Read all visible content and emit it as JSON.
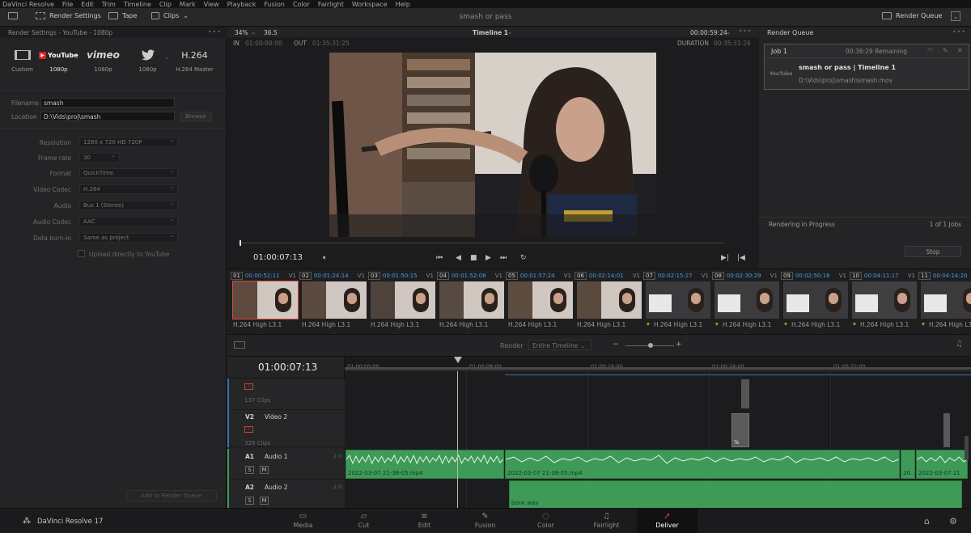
{
  "menu": [
    "DaVinci Resolve",
    "File",
    "Edit",
    "Trim",
    "Timeline",
    "Clip",
    "Mark",
    "View",
    "Playback",
    "Fusion",
    "Color",
    "Fairlight",
    "Workspace",
    "Help"
  ],
  "toolbar": {
    "render_settings": "Render Settings",
    "tape": "Tape",
    "clips": "Clips",
    "project_title": "smash or pass",
    "render_queue": "Render Queue"
  },
  "render_settings": {
    "header": "Render Settings - YouTube - 1080p",
    "presets": [
      {
        "logo": "",
        "label": "Custom"
      },
      {
        "logo": "YouTube",
        "label": "1080p"
      },
      {
        "logo": "vimeo",
        "label": "1080p"
      },
      {
        "logo": "twitter",
        "label": "1080p"
      },
      {
        "logo": "H.264",
        "label": "H.264 Master"
      }
    ],
    "filename_label": "Filename",
    "filename": "smash",
    "location_label": "Location",
    "location": "D:\\Vids\\proj\\smash",
    "browse": "Browse",
    "fields": [
      {
        "label": "Resolution",
        "value": "1280 x 720 HD 720P"
      },
      {
        "label": "Frame rate",
        "value": "30"
      },
      {
        "label": "Format",
        "value": "QuickTime"
      },
      {
        "label": "Video Codec",
        "value": "H.264"
      },
      {
        "label": "Audio",
        "value": "Bus 1 (Stereo)"
      },
      {
        "label": "Audio Codec",
        "value": "AAC"
      },
      {
        "label": "Data burn-in",
        "value": "Same as project"
      }
    ],
    "upload": "Upload directly to YouTube",
    "add_to_queue": "Add to Render Queue"
  },
  "viewer": {
    "zoom": "34%",
    "fps": "36.5",
    "timeline_name": "Timeline 1",
    "duration_tc": "00:00:59:24",
    "in_label": "IN",
    "in_tc": "01:00:00:00",
    "out_label": "OUT",
    "out_tc": "01:35:31:25",
    "duration_label": "DURATION",
    "duration_val": "00:35:31:26",
    "timecode": "01:00:07:13"
  },
  "render_queue": {
    "title": "Render Queue",
    "job_name": "Job 1",
    "remaining": "00:36:29 Remaining",
    "job_title": "smash or pass | Timeline 1",
    "job_path": "D:\\Vids\\proj\\smash\\smash.mov",
    "job_logo": "YouTube",
    "status": "Rendering in Progress",
    "count": "1 of 1 Jobs",
    "stop": "Stop"
  },
  "clips": [
    {
      "num": "01",
      "tc": "00:00:52:11",
      "track": "V1",
      "codec": "H.264 High L3.1",
      "star": false
    },
    {
      "num": "02",
      "tc": "00:01:24:14",
      "track": "V1",
      "codec": "H.264 High L3.1",
      "star": false
    },
    {
      "num": "03",
      "tc": "00:01:50:15",
      "track": "V1",
      "codec": "H.264 High L3.1",
      "star": false
    },
    {
      "num": "04",
      "tc": "00:01:52:08",
      "track": "V1",
      "codec": "H.264 High L3.1",
      "star": false
    },
    {
      "num": "05",
      "tc": "00:01:57:24",
      "track": "V1",
      "codec": "H.264 High L3.1",
      "star": false
    },
    {
      "num": "06",
      "tc": "00:02:14:01",
      "track": "V1",
      "codec": "H.264 High L3.1",
      "star": false
    },
    {
      "num": "07",
      "tc": "00:02:15:27",
      "track": "V1",
      "codec": "H.264 High L3.1",
      "star": true
    },
    {
      "num": "08",
      "tc": "00:02:30:29",
      "track": "V1",
      "codec": "H.264 High L3.1",
      "star": true
    },
    {
      "num": "09",
      "tc": "00:02:50:16",
      "track": "V1",
      "codec": "H.264 High L3.1",
      "star": true
    },
    {
      "num": "10",
      "tc": "00:04:11:17",
      "track": "V1",
      "codec": "H.264 High L3.1",
      "star": true
    },
    {
      "num": "11",
      "tc": "00:04:14:20",
      "track": "V1",
      "codec": "H.264 High L3.1",
      "star": true
    }
  ],
  "timeline": {
    "render_label": "Render",
    "render_value": "Entire Timeline",
    "timecode": "01:00:07:13",
    "ruler": [
      "01:00:00:00",
      "01:00:08:00",
      "01:00:16:00",
      "01:00:24:00",
      "01:00:32:00"
    ],
    "v1_clips": "137 Clips",
    "v2_id": "V2",
    "v2_name": "Video 2",
    "v2_clips": "328 Clips",
    "a1_id": "A1",
    "a1_name": "Audio 1",
    "a1_level": "2.0",
    "a2_id": "A2",
    "a2_name": "Audio 2",
    "a2_level": "2.0",
    "solo": "S",
    "mute": "M",
    "a1_clip1": "2022-03-07 21-38-05.mp4",
    "a1_clip2": "2022-03-07 21-38-05.mp4",
    "a1_clip3": "20...",
    "a1_clip4": "2022-03-07 21",
    "a2_clip1": "bonk.wav",
    "v_small": "Te"
  },
  "pages": [
    "Media",
    "Cut",
    "Edit",
    "Fusion",
    "Color",
    "Fairlight",
    "Deliver"
  ],
  "active_page": "Deliver",
  "app_name": "DaVinci Resolve 17",
  "colors": {
    "accent": "#d84a3a",
    "timecode_blue": "#4a9ce0",
    "audio_green": "#3e9a57"
  }
}
